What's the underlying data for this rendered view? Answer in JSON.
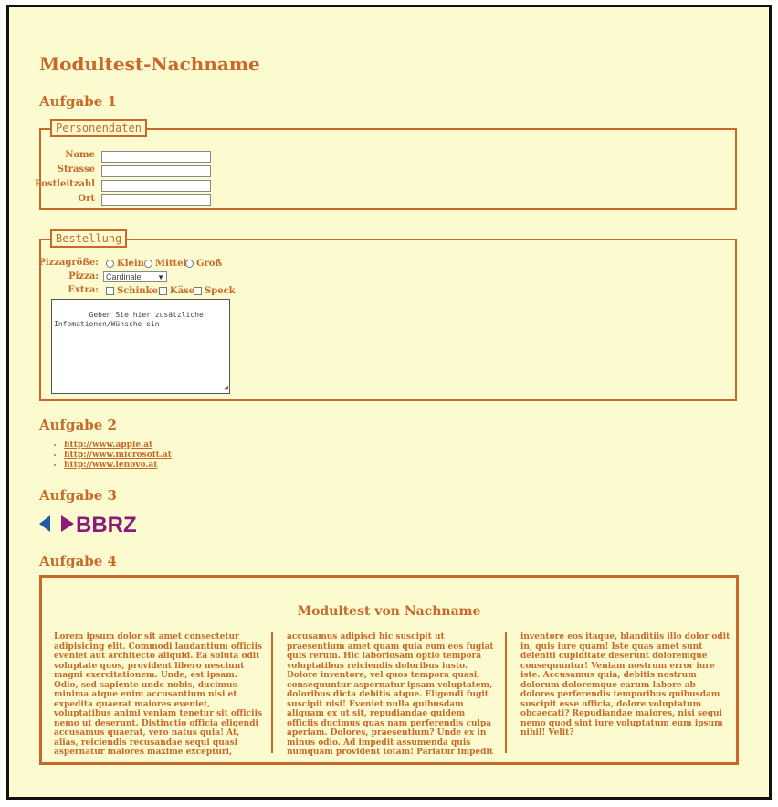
{
  "page_title": "Modultest-Nachname",
  "tasks": [
    "Aufgabe 1",
    "Aufgabe 2",
    "Aufgabe 3",
    "Aufgabe 4"
  ],
  "person": {
    "legend": "Personendaten",
    "fields": [
      "Name",
      "Strasse",
      "Postleitzahl",
      "Ort"
    ]
  },
  "order": {
    "legend": "Bestellung",
    "size_label": "Pizzagröße:",
    "sizes": [
      "Klein",
      "Mittel",
      "Groß"
    ],
    "pizza_label": "Pizza:",
    "pizza_selected": "Cardinale",
    "extra_label": "Extra:",
    "extras": [
      "Schinken",
      "Käse",
      "Speck"
    ],
    "textarea_placeholder": "Geben Sie hier zusätzliche\nInfomationen/Wünsche ein"
  },
  "links": [
    "http://www.apple.at",
    "http://www.microsoft.at",
    "http://www.lenovo.at"
  ],
  "logo": {
    "text": "BBRZ",
    "colors": {
      "left": "#1e5aa8",
      "right": "#8b1a7a",
      "text": "#8b1a7a"
    }
  },
  "article": {
    "title": "Modultest von Nachname",
    "columns": [
      "Lorem ipsum dolor sit amet consectetur adipisicing elit. Commodi laudantium officiis eveniet aut architecto aliquid. Ea soluta odit voluptate quos, provident libero nesciunt magni exercitationem. Unde, est ipsam. Odio, sed sapiente unde nobis, ducimus minima atque enim accusantium nisi et expedita quaerat maiores eveniet, voluptatibus animi veniam tenetur sit officiis nemo ut deserunt. Distinctio officia eligendi accusamus quaerat, vero natus quia! At, alias, reiciendis recusandae sequi quasi aspernatur maiores maxime excepturi,",
      "accusamus adipisci hic suscipit ut praesentium amet quam quia eum eos fugiat quis rerum. Hic laboriosam optio tempora voluptatibus reiciendis doloribus iusto. Dolore inventore, vel quos tempora quasi, consequuntur aspernatur ipsam voluptatem, doloribus dicta debitis atque. Eligendi fugit suscipit nisi! Eveniet nulla quibusdam aliquam ex ut sit, repudiandae quidem officiis ducimus quas nam perferendis culpa aperiam. Dolores, praesentium? Unde ex in minus odio. Ad impedit assumenda quis numquam provident totam! Pariatur impedit",
      "inventore eos itaque, blanditiis illo dolor odit in, quis iure quam! Iste quas amet sunt deleniti cupiditate deserunt doloremque consequuntur! Veniam nostrum error iure iste. Accusamus quia, debitis nostrum dolorum doloremque earum labore ab dolores perferendis temporibus quibusdam suscipit esse officia, dolore voluptatum obcaecati? Repudiandae maiores, nisi sequi nemo quod sint iure voluptatum eum ipsum nihil! Velit?"
    ]
  },
  "colors": {
    "accent": "#c8682a",
    "background": "#fbfbcf",
    "frame": "#111111"
  }
}
